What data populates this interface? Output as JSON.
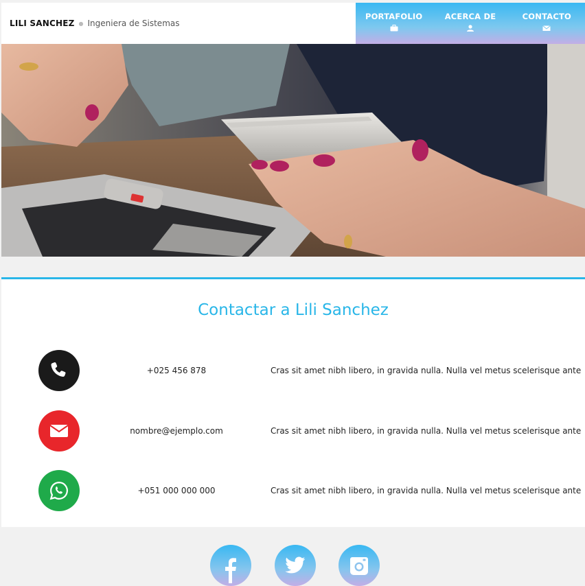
{
  "header": {
    "brand_name": "LILI SANCHEZ",
    "brand_subtitle": "Ingeniera de Sistemas",
    "nav": [
      {
        "label": "PORTAFOLIO",
        "icon": "briefcase-icon"
      },
      {
        "label": "ACERCA DE",
        "icon": "user-icon"
      },
      {
        "label": "CONTACTO",
        "icon": "envelope-icon"
      }
    ]
  },
  "hero": {
    "image": "woman-holding-smartphone-over-laptop-photo"
  },
  "contact": {
    "title": "Contactar a Lili Sanchez",
    "rows": [
      {
        "icon": "phone-icon",
        "color": "#1a1a1a",
        "value": "+025 456 878",
        "description": "Cras sit amet nibh libero, in gravida nulla. Nulla vel metus scelerisque ante"
      },
      {
        "icon": "envelope-icon",
        "color": "#e8262b",
        "value": "nombre@ejemplo.com",
        "description": "Cras sit amet nibh libero, in gravida nulla. Nulla vel metus scelerisque ante"
      },
      {
        "icon": "whatsapp-icon",
        "color": "#1faa4a",
        "value": "+051 000 000 000",
        "description": "Cras sit amet nibh libero, in gravida nulla. Nulla vel metus scelerisque ante"
      }
    ]
  },
  "social": [
    {
      "icon": "facebook-icon"
    },
    {
      "icon": "twitter-icon"
    },
    {
      "icon": "instagram-icon"
    }
  ],
  "colors": {
    "accent": "#29b6e8",
    "background": "#f1f1f1"
  }
}
